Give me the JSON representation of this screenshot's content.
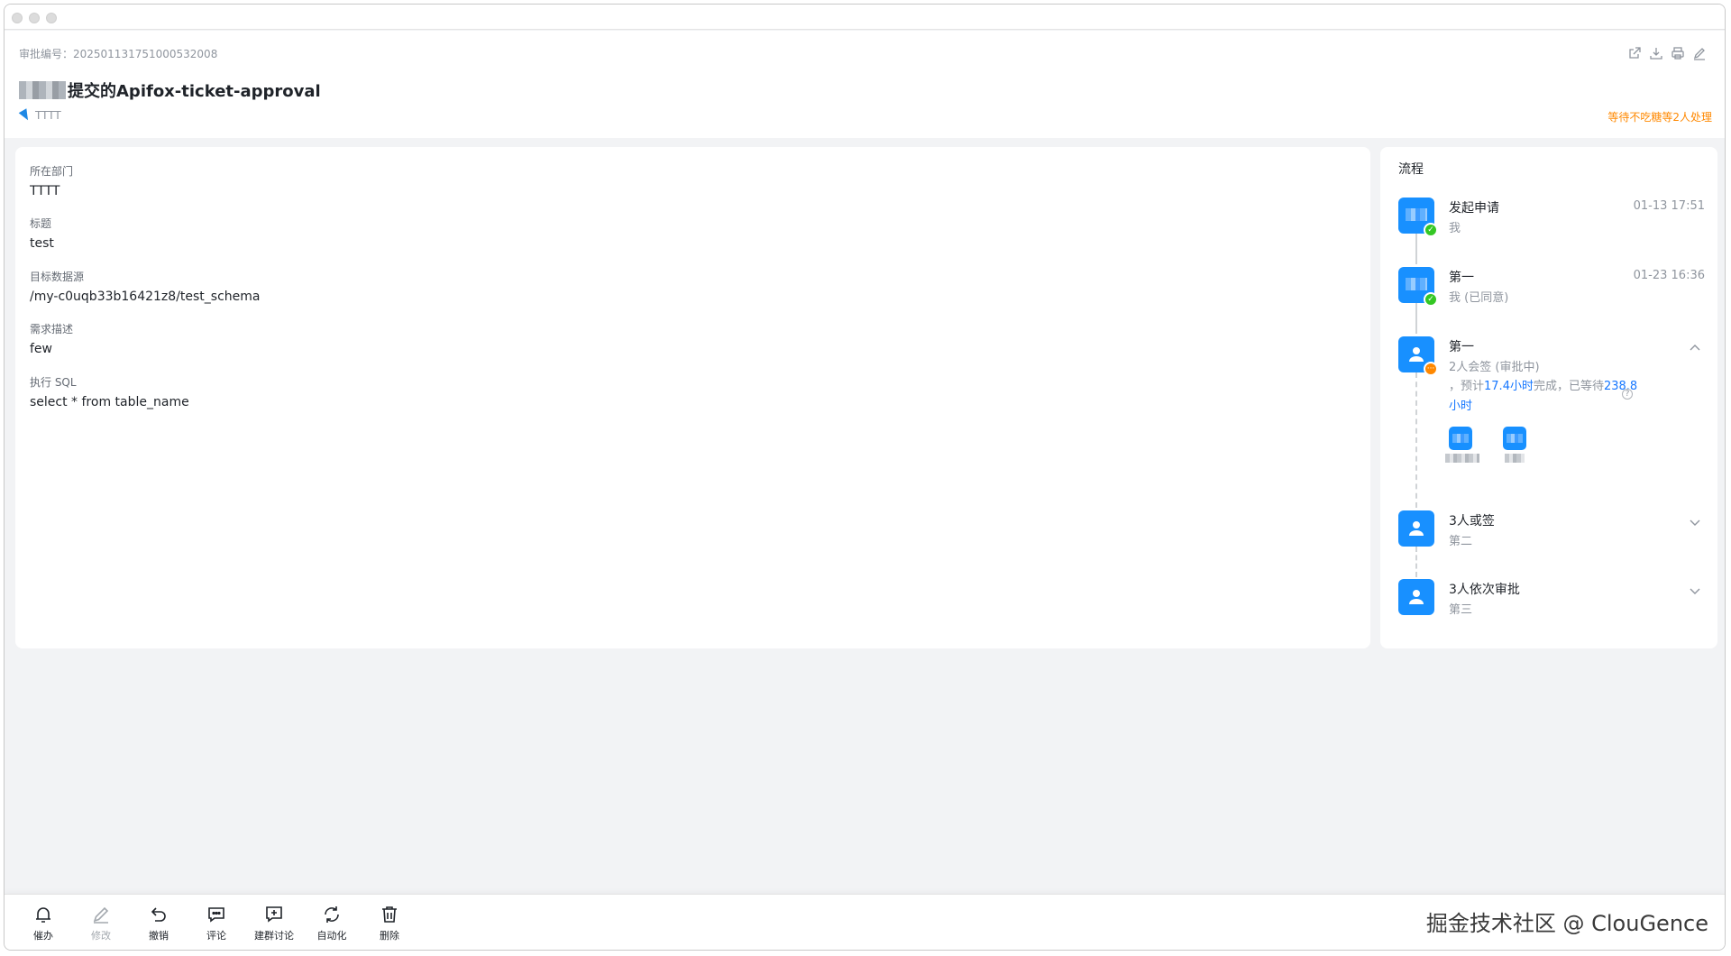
{
  "header": {
    "serial": "审批编号：202501131751000532008",
    "title": "提交的Apifox-ticket-approval",
    "dept": "TTTT",
    "status": "等待不吃糖等2人处理",
    "actions": [
      "share-icon",
      "download-icon",
      "print-icon",
      "edit-icon"
    ]
  },
  "form": {
    "fields": [
      {
        "label": "所在部门",
        "value": "TTTT"
      },
      {
        "label": "标题",
        "value": "test"
      },
      {
        "label": "目标数据源",
        "value": "/my-c0uqb33b16421z8/test_schema"
      },
      {
        "label": "需求描述",
        "value": "few"
      },
      {
        "label": "执行 SQL",
        "value": "select * from table_name"
      }
    ]
  },
  "flow": {
    "title": "流程",
    "nodes": [
      {
        "name": "发起申请",
        "sub": "我",
        "time": "01-13 17:51"
      },
      {
        "name": "第一",
        "sub": "我 (已同意)",
        "time": "01-23 16:36"
      },
      {
        "name": "第一",
        "sub": "2人会签 (审批中)",
        "est_prefix": "，预计",
        "est_time": "17.4小时",
        "est_mid": "完成，已等待",
        "est_wait": "238.8小时"
      },
      {
        "name": "3人或签",
        "sub": "第二"
      },
      {
        "name": "3人依次审批",
        "sub": "第三"
      }
    ]
  },
  "toolbar": {
    "items": [
      {
        "label": "催办",
        "icon": "bell-icon"
      },
      {
        "label": "修改",
        "icon": "pencil-icon"
      },
      {
        "label": "撤销",
        "icon": "undo-icon"
      },
      {
        "label": "评论",
        "icon": "comment-icon"
      },
      {
        "label": "建群讨论",
        "icon": "group-chat-icon"
      },
      {
        "label": "自动化",
        "icon": "refresh-icon"
      },
      {
        "label": "删除",
        "icon": "trash-icon"
      }
    ]
  },
  "watermark": "掘金技术社区 @ ClouGence"
}
